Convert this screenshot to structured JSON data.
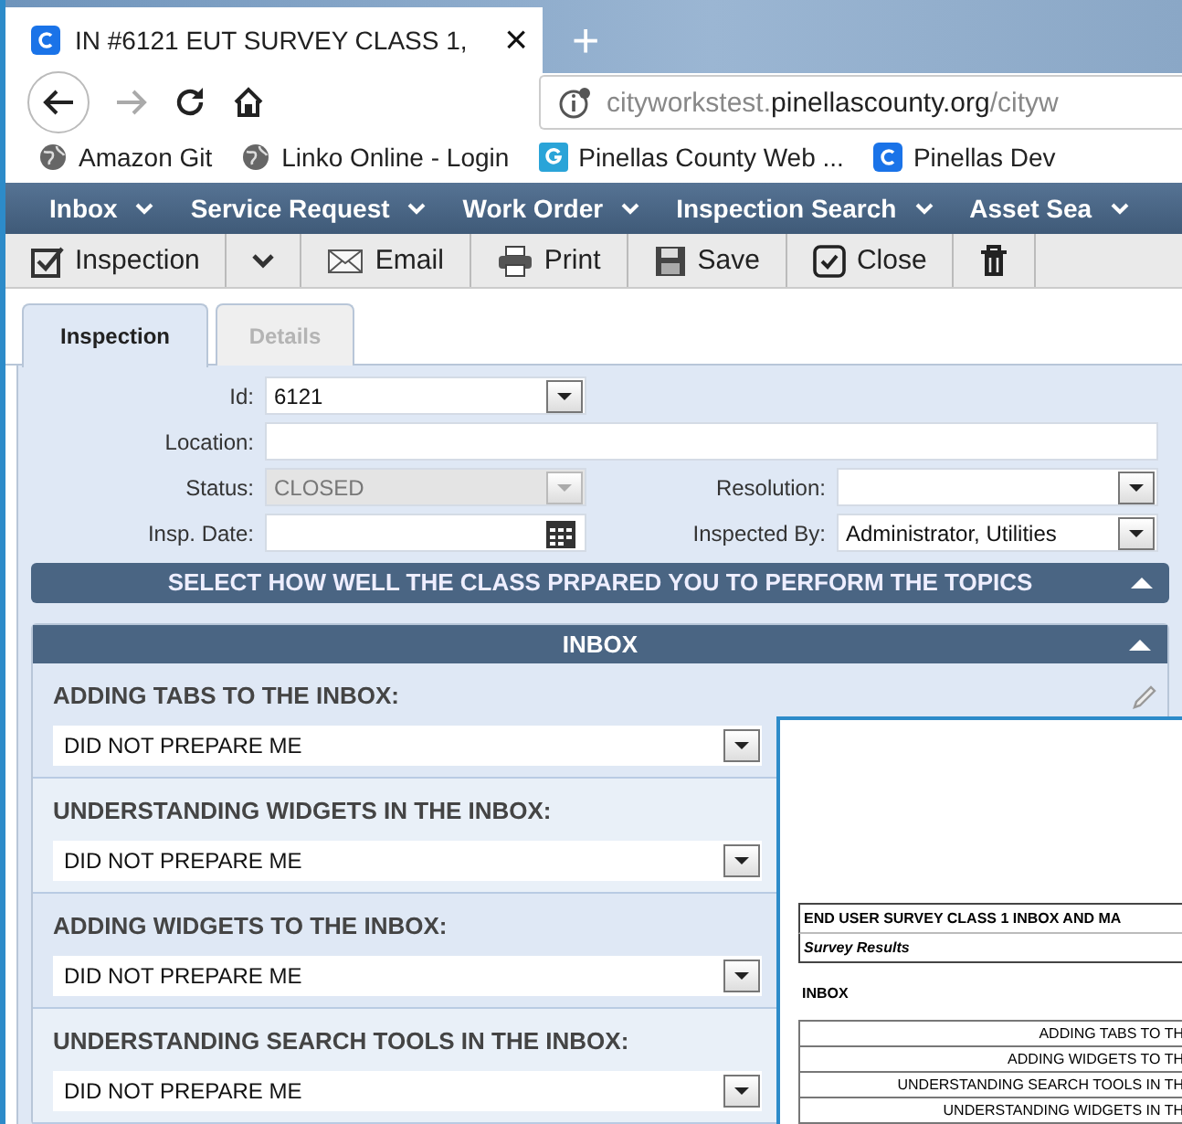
{
  "browser": {
    "tab_title": "IN #6121 EUT SURVEY CLASS 1,",
    "tab_close": "×",
    "new_tab": "+",
    "url": {
      "subdomain": "cityworkstest.",
      "domain": "pinellascounty.org",
      "path": "/cityw"
    },
    "bookmarks": [
      {
        "label": "Amazon Git",
        "kind": "globe"
      },
      {
        "label": "Linko Online - Login",
        "kind": "globe"
      },
      {
        "label": "Pinellas County Web ...",
        "kind": "g"
      },
      {
        "label": "Pinellas Dev",
        "kind": "c"
      }
    ]
  },
  "menu": [
    {
      "label": "Inbox"
    },
    {
      "label": "Service Request"
    },
    {
      "label": "Work Order"
    },
    {
      "label": "Inspection Search"
    },
    {
      "label": "Asset Sea"
    }
  ],
  "toolbar": [
    {
      "label": "Inspection",
      "kind": "check"
    },
    {
      "kind": "caret"
    },
    {
      "label": "Email",
      "kind": "mail"
    },
    {
      "label": "Print",
      "kind": "print"
    },
    {
      "label": "Save",
      "kind": "save"
    },
    {
      "label": "Close",
      "kind": "close"
    },
    {
      "kind": "trash"
    }
  ],
  "tabs": [
    {
      "label": "Inspection",
      "selected": true
    },
    {
      "label": "Details",
      "selected": false
    }
  ],
  "form": {
    "rows": [
      {
        "left": {
          "label": "Id:",
          "value": "6121",
          "kind": "select",
          "disabled": false
        }
      },
      {
        "left": {
          "label": "Location:",
          "kind": "wide"
        }
      },
      {
        "left": {
          "label": "Status:",
          "value": "CLOSED",
          "kind": "select",
          "disabled": true
        },
        "right": {
          "label": "Resolution:",
          "kind": "select",
          "disabled": false
        }
      },
      {
        "left": {
          "label": "Insp. Date:",
          "kind": "date"
        },
        "right": {
          "label": "Inspected By:",
          "value": "Administrator, Utilities",
          "kind": "select",
          "disabled": false
        }
      }
    ]
  },
  "section": {
    "title": "SELECT HOW WELL THE CLASS PRPARED YOU TO PERFORM THE TOPICS"
  },
  "inbox": {
    "title": "INBOX",
    "questions": [
      {
        "label": "ADDING TABS TO THE INBOX:",
        "value": "DID NOT PREPARE ME"
      },
      {
        "label": "UNDERSTANDING WIDGETS IN THE INBOX:",
        "value": "DID NOT PREPARE ME"
      },
      {
        "label": "ADDING WIDGETS TO THE INBOX:",
        "value": "DID NOT PREPARE ME"
      },
      {
        "label": "UNDERSTANDING SEARCH TOOLS IN THE INBOX:",
        "value": "DID NOT PREPARE ME"
      }
    ]
  },
  "document": {
    "title": "END USER SURVEY CLASS 1 INBOX AND MA",
    "subtitle": "Survey Results",
    "section": "INBOX",
    "rows": [
      "ADDING TABS TO TH",
      "ADDING WIDGETS TO TH",
      "UNDERSTANDING SEARCH TOOLS IN TH",
      "UNDERSTANDING WIDGETS IN TH"
    ]
  }
}
